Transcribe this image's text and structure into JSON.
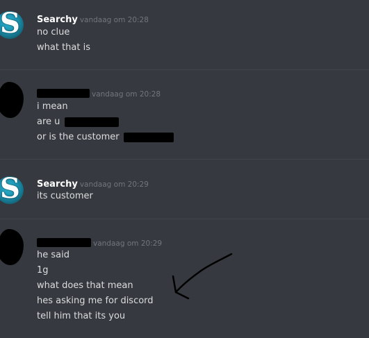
{
  "messages": [
    {
      "author": "Searchy",
      "timestamp": "vandaag om 20:28",
      "avatar": "searchy-logo",
      "lines": [
        "no clue",
        "what that is"
      ]
    },
    {
      "author": "",
      "timestamp": "vandaag om 20:28",
      "avatar": "redacted",
      "lines": [
        "i mean",
        "are u",
        "or is the customer"
      ]
    },
    {
      "author": "Searchy",
      "timestamp": "vandaag om 20:29",
      "avatar": "searchy-logo",
      "lines": [
        "its customer"
      ]
    },
    {
      "author": "",
      "timestamp": "vandaag om 20:29",
      "avatar": "redacted",
      "lines": [
        "he said",
        "1g",
        "what does that mean",
        "hes asking me for discord",
        "tell him that its you"
      ]
    }
  ],
  "colors": {
    "background": "#36393f",
    "text": "#dcddde",
    "username": "#ffffff",
    "timestamp": "#72767d",
    "avatar_accent": "#1b8fab"
  }
}
